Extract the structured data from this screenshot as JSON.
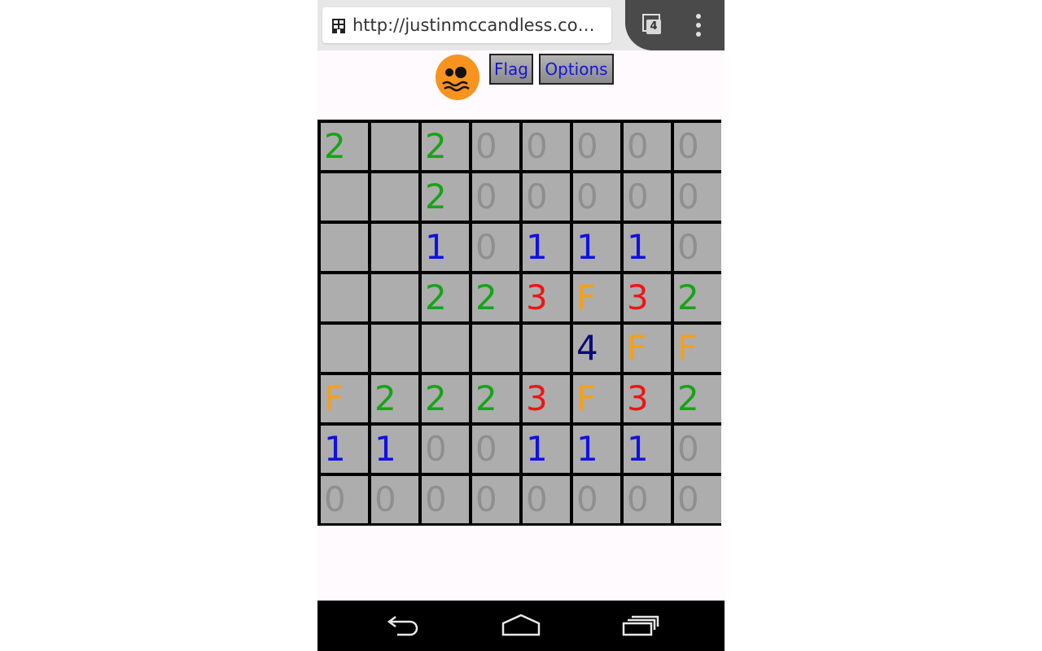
{
  "browser": {
    "url": "http://justinmccandless.com/de...",
    "tab_count": "4"
  },
  "toolbar": {
    "face_icon": "sad-face-icon",
    "flag_label": "Flag",
    "options_label": "Options"
  },
  "colors": {
    "face": "#f7931e",
    "num1": "#1010e6",
    "num2": "#16a316",
    "num3": "#ee1515",
    "num4": "#0b0b75",
    "flag": "#f4a01a",
    "zero": "#8f8f8f",
    "cell_bg": "#adadad"
  },
  "board": {
    "rows": [
      [
        "2",
        "",
        "2",
        "0",
        "0",
        "0",
        "0",
        "0"
      ],
      [
        "",
        "",
        "2",
        "0",
        "0",
        "0",
        "0",
        "0"
      ],
      [
        "",
        "",
        "1",
        "0",
        "1",
        "1",
        "1",
        "0"
      ],
      [
        "",
        "",
        "2",
        "2",
        "3",
        "F",
        "3",
        "2"
      ],
      [
        "",
        "",
        "",
        "",
        "",
        "4",
        "F",
        "F"
      ],
      [
        "F",
        "2",
        "2",
        "2",
        "3",
        "F",
        "3",
        "2"
      ],
      [
        "1",
        "1",
        "0",
        "0",
        "1",
        "1",
        "1",
        "0"
      ],
      [
        "0",
        "0",
        "0",
        "0",
        "0",
        "0",
        "0",
        "0"
      ]
    ]
  },
  "navbar": {
    "back_icon": "back-icon",
    "home_icon": "home-icon",
    "recents_icon": "recent-apps-icon"
  }
}
